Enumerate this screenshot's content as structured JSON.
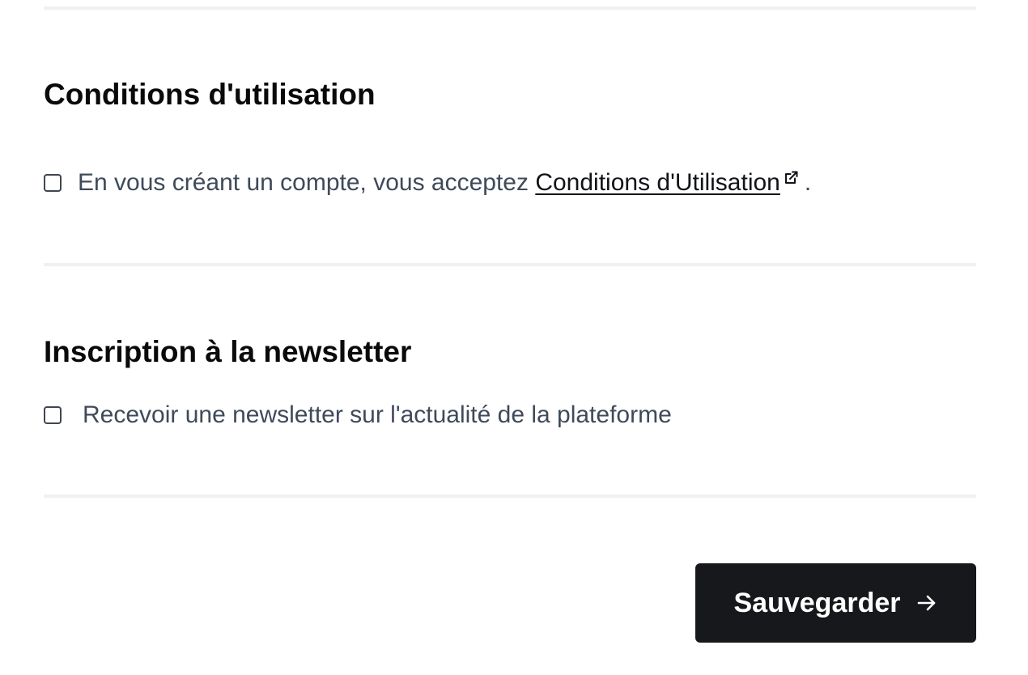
{
  "terms_section": {
    "title": "Conditions d'utilisation",
    "checkbox_checked": false,
    "text_before_link": "En vous créant un compte, vous acceptez ",
    "link_label": "Conditions d'Utilisation",
    "link_icon": "external-link-icon",
    "text_after_link": "."
  },
  "newsletter_section": {
    "title": "Inscription à la newsletter",
    "checkbox_checked": false,
    "label": "Recevoir une newsletter sur l'actualité de la plateforme"
  },
  "actions": {
    "save_label": "Sauvegarder",
    "save_icon": "arrow-right-icon"
  },
  "colors": {
    "primary_button": "#17181b",
    "body_text": "#3f4a5a",
    "heading_text": "#0a0a0a",
    "divider": "#eef0f2"
  }
}
